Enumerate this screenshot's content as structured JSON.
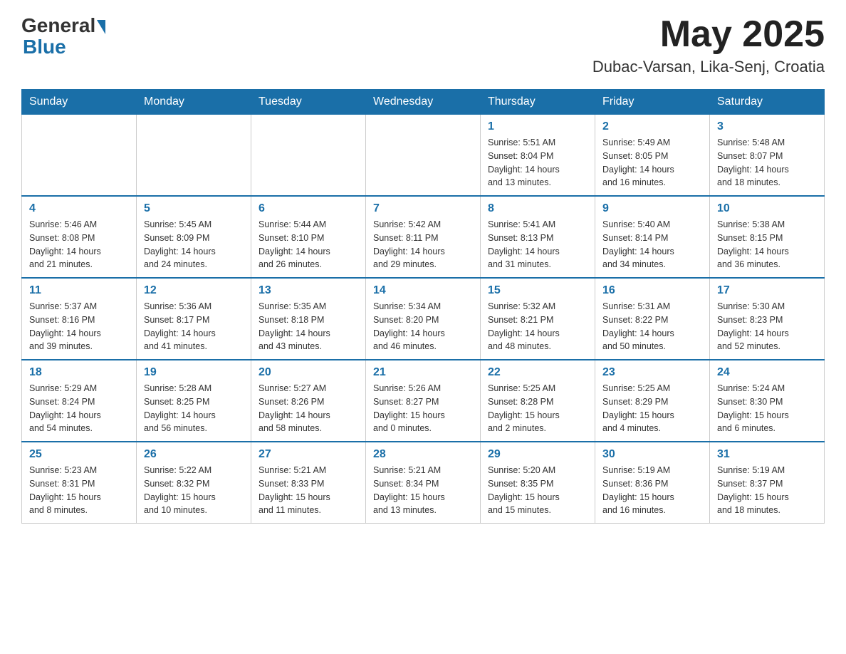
{
  "header": {
    "logo_general": "General",
    "logo_blue": "Blue",
    "title": "May 2025",
    "location": "Dubac-Varsan, Lika-Senj, Croatia"
  },
  "days_of_week": [
    "Sunday",
    "Monday",
    "Tuesday",
    "Wednesday",
    "Thursday",
    "Friday",
    "Saturday"
  ],
  "weeks": [
    [
      {
        "day": "",
        "info": ""
      },
      {
        "day": "",
        "info": ""
      },
      {
        "day": "",
        "info": ""
      },
      {
        "day": "",
        "info": ""
      },
      {
        "day": "1",
        "info": "Sunrise: 5:51 AM\nSunset: 8:04 PM\nDaylight: 14 hours\nand 13 minutes."
      },
      {
        "day": "2",
        "info": "Sunrise: 5:49 AM\nSunset: 8:05 PM\nDaylight: 14 hours\nand 16 minutes."
      },
      {
        "day": "3",
        "info": "Sunrise: 5:48 AM\nSunset: 8:07 PM\nDaylight: 14 hours\nand 18 minutes."
      }
    ],
    [
      {
        "day": "4",
        "info": "Sunrise: 5:46 AM\nSunset: 8:08 PM\nDaylight: 14 hours\nand 21 minutes."
      },
      {
        "day": "5",
        "info": "Sunrise: 5:45 AM\nSunset: 8:09 PM\nDaylight: 14 hours\nand 24 minutes."
      },
      {
        "day": "6",
        "info": "Sunrise: 5:44 AM\nSunset: 8:10 PM\nDaylight: 14 hours\nand 26 minutes."
      },
      {
        "day": "7",
        "info": "Sunrise: 5:42 AM\nSunset: 8:11 PM\nDaylight: 14 hours\nand 29 minutes."
      },
      {
        "day": "8",
        "info": "Sunrise: 5:41 AM\nSunset: 8:13 PM\nDaylight: 14 hours\nand 31 minutes."
      },
      {
        "day": "9",
        "info": "Sunrise: 5:40 AM\nSunset: 8:14 PM\nDaylight: 14 hours\nand 34 minutes."
      },
      {
        "day": "10",
        "info": "Sunrise: 5:38 AM\nSunset: 8:15 PM\nDaylight: 14 hours\nand 36 minutes."
      }
    ],
    [
      {
        "day": "11",
        "info": "Sunrise: 5:37 AM\nSunset: 8:16 PM\nDaylight: 14 hours\nand 39 minutes."
      },
      {
        "day": "12",
        "info": "Sunrise: 5:36 AM\nSunset: 8:17 PM\nDaylight: 14 hours\nand 41 minutes."
      },
      {
        "day": "13",
        "info": "Sunrise: 5:35 AM\nSunset: 8:18 PM\nDaylight: 14 hours\nand 43 minutes."
      },
      {
        "day": "14",
        "info": "Sunrise: 5:34 AM\nSunset: 8:20 PM\nDaylight: 14 hours\nand 46 minutes."
      },
      {
        "day": "15",
        "info": "Sunrise: 5:32 AM\nSunset: 8:21 PM\nDaylight: 14 hours\nand 48 minutes."
      },
      {
        "day": "16",
        "info": "Sunrise: 5:31 AM\nSunset: 8:22 PM\nDaylight: 14 hours\nand 50 minutes."
      },
      {
        "day": "17",
        "info": "Sunrise: 5:30 AM\nSunset: 8:23 PM\nDaylight: 14 hours\nand 52 minutes."
      }
    ],
    [
      {
        "day": "18",
        "info": "Sunrise: 5:29 AM\nSunset: 8:24 PM\nDaylight: 14 hours\nand 54 minutes."
      },
      {
        "day": "19",
        "info": "Sunrise: 5:28 AM\nSunset: 8:25 PM\nDaylight: 14 hours\nand 56 minutes."
      },
      {
        "day": "20",
        "info": "Sunrise: 5:27 AM\nSunset: 8:26 PM\nDaylight: 14 hours\nand 58 minutes."
      },
      {
        "day": "21",
        "info": "Sunrise: 5:26 AM\nSunset: 8:27 PM\nDaylight: 15 hours\nand 0 minutes."
      },
      {
        "day": "22",
        "info": "Sunrise: 5:25 AM\nSunset: 8:28 PM\nDaylight: 15 hours\nand 2 minutes."
      },
      {
        "day": "23",
        "info": "Sunrise: 5:25 AM\nSunset: 8:29 PM\nDaylight: 15 hours\nand 4 minutes."
      },
      {
        "day": "24",
        "info": "Sunrise: 5:24 AM\nSunset: 8:30 PM\nDaylight: 15 hours\nand 6 minutes."
      }
    ],
    [
      {
        "day": "25",
        "info": "Sunrise: 5:23 AM\nSunset: 8:31 PM\nDaylight: 15 hours\nand 8 minutes."
      },
      {
        "day": "26",
        "info": "Sunrise: 5:22 AM\nSunset: 8:32 PM\nDaylight: 15 hours\nand 10 minutes."
      },
      {
        "day": "27",
        "info": "Sunrise: 5:21 AM\nSunset: 8:33 PM\nDaylight: 15 hours\nand 11 minutes."
      },
      {
        "day": "28",
        "info": "Sunrise: 5:21 AM\nSunset: 8:34 PM\nDaylight: 15 hours\nand 13 minutes."
      },
      {
        "day": "29",
        "info": "Sunrise: 5:20 AM\nSunset: 8:35 PM\nDaylight: 15 hours\nand 15 minutes."
      },
      {
        "day": "30",
        "info": "Sunrise: 5:19 AM\nSunset: 8:36 PM\nDaylight: 15 hours\nand 16 minutes."
      },
      {
        "day": "31",
        "info": "Sunrise: 5:19 AM\nSunset: 8:37 PM\nDaylight: 15 hours\nand 18 minutes."
      }
    ]
  ]
}
